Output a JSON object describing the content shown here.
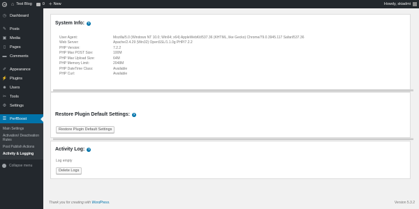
{
  "adminbar": {
    "site_name": "Test Blog",
    "comments_count": "0",
    "new_label": "New",
    "howdy": "Howdy, skiadmi"
  },
  "sidebar": {
    "items": [
      {
        "label": "Dashboard",
        "icon": "dashboard-icon"
      },
      {
        "label": "Posts",
        "icon": "pin-icon"
      },
      {
        "label": "Media",
        "icon": "media-icon"
      },
      {
        "label": "Pages",
        "icon": "page-icon"
      },
      {
        "label": "Comments",
        "icon": "comment-icon"
      },
      {
        "label": "Appearance",
        "icon": "brush-icon"
      },
      {
        "label": "Plugins",
        "icon": "plug-icon"
      },
      {
        "label": "Users",
        "icon": "user-icon"
      },
      {
        "label": "Tools",
        "icon": "wrench-icon"
      },
      {
        "label": "Settings",
        "icon": "settings-icon"
      }
    ],
    "current": {
      "label": "PerfBoost",
      "icon": "perfboost-icon"
    },
    "submenu": [
      "Main Settings",
      "Activation/ Deactivation Rules",
      "Post Publish Actions",
      "Activity & Logging"
    ],
    "collapse_label": "Collapse menu"
  },
  "system_info": {
    "title": "System Info:",
    "rows": [
      {
        "key": "User Agent:",
        "value": "Mozilla/5.0 (Windows NT 10.0; Win64; x64) AppleWebKit/537.36 (KHTML, like Gecko) Chrome/79.0.3945.117 Safari/537.36"
      },
      {
        "key": "Web Server:",
        "value": "Apache/2.4.29 (Win32) OpenSSL/1.1.0g PHP/7.2.2"
      },
      {
        "key": "PHP Version:",
        "value": "7.2.2"
      },
      {
        "key": "PHP Max POST Size:",
        "value": "100M"
      },
      {
        "key": "PHP Max Upload Size:",
        "value": "64M"
      },
      {
        "key": "PHP Memory Limit:",
        "value": "2048M"
      },
      {
        "key": "PHP DateTime Class:",
        "value": "Available"
      },
      {
        "key": "PHP Curl:",
        "value": "Available"
      }
    ]
  },
  "restore": {
    "title": "Restore Plugin Default Settings:",
    "button": "Restore Plugin Default Settings"
  },
  "activity": {
    "title": "Activity Log:",
    "empty": "Log empty",
    "button": "Delete Logs"
  },
  "footer": {
    "thanks": "Thank you for creating with ",
    "link": "WordPress",
    "thanks_end": ".",
    "version": "Version 5.3.2"
  },
  "colors": {
    "adminbar": "#23282d",
    "accent": "#0073aa",
    "submenu_bg": "#32373c"
  }
}
